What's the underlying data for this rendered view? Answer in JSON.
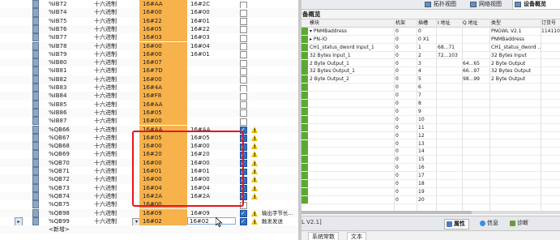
{
  "watch_table": {
    "rows": [
      {
        "address": "%IB72",
        "format": "十六进制",
        "monitor": "16#AA",
        "modify": "16#2C",
        "checked": false,
        "warn": false,
        "note": ""
      },
      {
        "address": "%IB74",
        "format": "十六进制",
        "monitor": "16#00",
        "modify": "16#00",
        "checked": false,
        "warn": false,
        "note": ""
      },
      {
        "address": "%IB75",
        "format": "十六进制",
        "monitor": "16#22",
        "modify": "16#01",
        "checked": false,
        "warn": false,
        "note": ""
      },
      {
        "address": "%IB76",
        "format": "十六进制",
        "monitor": "16#05",
        "modify": "16#22",
        "checked": false,
        "warn": false,
        "note": ""
      },
      {
        "address": "%IB77",
        "format": "十六进制",
        "monitor": "16#03",
        "modify": "16#03",
        "checked": false,
        "warn": false,
        "note": ""
      },
      {
        "address": "%IB78",
        "format": "十六进制",
        "monitor": "16#00",
        "modify": "16#04",
        "checked": false,
        "warn": false,
        "note": ""
      },
      {
        "address": "%IB79",
        "format": "十六进制",
        "monitor": "16#00",
        "modify": "16#01",
        "checked": false,
        "warn": false,
        "note": ""
      },
      {
        "address": "%IB80",
        "format": "十六进制",
        "monitor": "16#07",
        "modify": "",
        "checked": false,
        "warn": false,
        "note": ""
      },
      {
        "address": "%IB81",
        "format": "十六进制",
        "monitor": "16#7D",
        "modify": "",
        "checked": false,
        "warn": false,
        "note": ""
      },
      {
        "address": "%IB82",
        "format": "十六进制",
        "monitor": "16#00",
        "modify": "",
        "checked": false,
        "warn": false,
        "note": ""
      },
      {
        "address": "%IB83",
        "format": "十六进制",
        "monitor": "16#4A",
        "modify": "",
        "checked": false,
        "warn": false,
        "note": ""
      },
      {
        "address": "%IB84",
        "format": "十六进制",
        "monitor": "16#F8",
        "modify": "",
        "checked": false,
        "warn": false,
        "note": ""
      },
      {
        "address": "%IB85",
        "format": "十六进制",
        "monitor": "16#AA",
        "modify": "",
        "checked": false,
        "warn": false,
        "note": ""
      },
      {
        "address": "%IB86",
        "format": "十六进制",
        "monitor": "16#05",
        "modify": "",
        "checked": false,
        "warn": false,
        "note": ""
      },
      {
        "address": "%IB87",
        "format": "十六进制",
        "monitor": "16#00",
        "modify": "",
        "checked": false,
        "warn": false,
        "note": ""
      },
      {
        "address": "%QB66",
        "format": "十六进制",
        "monitor": "16#AA",
        "modify": "16#AA",
        "checked": true,
        "warn": true,
        "note": ""
      },
      {
        "address": "%QB67",
        "format": "十六进制",
        "monitor": "16#05",
        "modify": "16#05",
        "checked": true,
        "warn": true,
        "note": ""
      },
      {
        "address": "%QB68",
        "format": "十六进制",
        "monitor": "16#00",
        "modify": "16#00",
        "checked": true,
        "warn": true,
        "note": ""
      },
      {
        "address": "%QB69",
        "format": "十六进制",
        "monitor": "16#20",
        "modify": "16#20",
        "checked": true,
        "warn": true,
        "note": ""
      },
      {
        "address": "%QB70",
        "format": "十六进制",
        "monitor": "16#00",
        "modify": "16#00",
        "checked": true,
        "warn": true,
        "note": ""
      },
      {
        "address": "%QB71",
        "format": "十六进制",
        "monitor": "16#01",
        "modify": "16#01",
        "checked": true,
        "warn": true,
        "note": ""
      },
      {
        "address": "%QB72",
        "format": "十六进制",
        "monitor": "16#00",
        "modify": "16#00",
        "checked": true,
        "warn": true,
        "note": ""
      },
      {
        "address": "%QB73",
        "format": "十六进制",
        "monitor": "16#04",
        "modify": "16#04",
        "checked": true,
        "warn": true,
        "note": ""
      },
      {
        "address": "%QB74",
        "format": "十六进制",
        "monitor": "16#2A",
        "modify": "16#2A",
        "checked": true,
        "warn": true,
        "note": ""
      },
      {
        "address": "%QB75",
        "format": "十六进制",
        "monitor": "16#00",
        "modify": "",
        "checked": false,
        "warn": false,
        "note": ""
      },
      {
        "address": "%QB98",
        "format": "十六进制",
        "monitor": "16#09",
        "modify": "16#09",
        "checked": true,
        "warn": true,
        "note": "输出字节长..."
      },
      {
        "address": "%QB99",
        "format": "十六进制",
        "monitor": "16#02",
        "modify": "16#02",
        "checked": true,
        "warn": true,
        "note": "触发发送"
      },
      {
        "address": "<新增>",
        "format": "",
        "monitor": "",
        "modify": "",
        "checked": false,
        "warn": false,
        "note": ""
      }
    ]
  },
  "right_pane": {
    "tabs": [
      {
        "label": "拓扑视图"
      },
      {
        "label": "网络视图"
      },
      {
        "label": "设备概览"
      }
    ],
    "overview_title": "备概览",
    "columns": {
      "module": "模块",
      "rack": "机架",
      "slot": "插槽",
      "i_addr": "I 地址",
      "q_addr": "Q 地址",
      "type": "类型",
      "order": "订货号"
    },
    "rows": [
      {
        "module": "▾ PNMBaddress",
        "rack": "0",
        "slot": "0",
        "i": "",
        "q": "",
        "type": "PNGWL V2.1",
        "order": "114110"
      },
      {
        "module": "  ▸ PN-IO",
        "rack": "0",
        "slot": "0 X1",
        "i": "",
        "q": "",
        "type": "PNMBaddress",
        "order": ""
      },
      {
        "module": "CH1_status_dword Input_1",
        "rack": "0",
        "slot": "1",
        "i": "68...71",
        "q": "",
        "type": "CH1_status_dword ...",
        "order": ""
      },
      {
        "module": "32 Bytes Input_1",
        "rack": "0",
        "slot": "2",
        "i": "72...103",
        "q": "",
        "type": "32 Bytes Input",
        "order": ""
      },
      {
        "module": "2 Byte Output_1",
        "rack": "0",
        "slot": "3",
        "i": "",
        "q": "64...65",
        "type": "2 Byte Output",
        "order": ""
      },
      {
        "module": "32 Bytes Output_1",
        "rack": "0",
        "slot": "4",
        "i": "",
        "q": "66...97",
        "type": "32 Bytes Output",
        "order": ""
      },
      {
        "module": "2 Byte Output_2",
        "rack": "0",
        "slot": "5",
        "i": "",
        "q": "98...99",
        "type": "2 Byte Output",
        "order": ""
      },
      {
        "module": "",
        "rack": "0",
        "slot": "6",
        "i": "",
        "q": "",
        "type": "",
        "order": ""
      },
      {
        "module": "",
        "rack": "0",
        "slot": "7",
        "i": "",
        "q": "",
        "type": "",
        "order": ""
      },
      {
        "module": "",
        "rack": "0",
        "slot": "8",
        "i": "",
        "q": "",
        "type": "",
        "order": ""
      },
      {
        "module": "",
        "rack": "0",
        "slot": "9",
        "i": "",
        "q": "",
        "type": "",
        "order": ""
      },
      {
        "module": "",
        "rack": "0",
        "slot": "10",
        "i": "",
        "q": "",
        "type": "",
        "order": ""
      },
      {
        "module": "",
        "rack": "0",
        "slot": "11",
        "i": "",
        "q": "",
        "type": "",
        "order": ""
      },
      {
        "module": "",
        "rack": "0",
        "slot": "12",
        "i": "",
        "q": "",
        "type": "",
        "order": ""
      },
      {
        "module": "",
        "rack": "0",
        "slot": "13",
        "i": "",
        "q": "",
        "type": "",
        "order": ""
      },
      {
        "module": "",
        "rack": "0",
        "slot": "14",
        "i": "",
        "q": "",
        "type": "",
        "order": ""
      },
      {
        "module": "",
        "rack": "0",
        "slot": "15",
        "i": "",
        "q": "",
        "type": "",
        "order": ""
      },
      {
        "module": "",
        "rack": "0",
        "slot": "16",
        "i": "",
        "q": "",
        "type": "",
        "order": ""
      },
      {
        "module": "",
        "rack": "0",
        "slot": "17",
        "i": "",
        "q": "",
        "type": "",
        "order": ""
      },
      {
        "module": "",
        "rack": "0",
        "slot": "18",
        "i": "",
        "q": "",
        "type": "",
        "order": ""
      },
      {
        "module": "",
        "rack": "0",
        "slot": "19",
        "i": "",
        "q": "",
        "type": "",
        "order": ""
      },
      {
        "module": "",
        "rack": "0",
        "slot": "20",
        "i": "",
        "q": "",
        "type": "",
        "order": ""
      }
    ],
    "props_title": "L V2.1]",
    "props_tabs": [
      {
        "label": "属性"
      },
      {
        "label": "信息"
      },
      {
        "label": "诊断"
      }
    ],
    "sub_tabs": [
      {
        "label": "系统常数"
      },
      {
        "label": "文本"
      }
    ]
  },
  "colors": {
    "monitor_bg": "#f7b24b",
    "highlight_box": "#e8151a",
    "checkbox_on": "#2f6fc7",
    "warning": "#f2c200",
    "module_ok": "#5ca832"
  }
}
